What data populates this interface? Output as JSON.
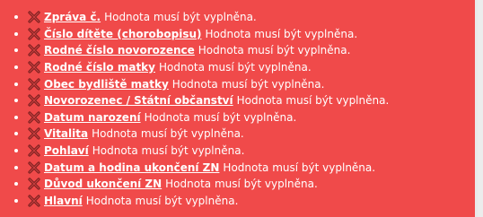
{
  "errors": [
    {
      "field": "Zpráva č.",
      "message": "Hodnota musí být vyplněna."
    },
    {
      "field": "Číslo dítěte (chorobopisu)",
      "message": "Hodnota musí být vyplněna."
    },
    {
      "field": "Rodné číslo novorozence",
      "message": "Hodnota musí být vyplněna."
    },
    {
      "field": "Rodné číslo matky",
      "message": "Hodnota musí být vyplněna."
    },
    {
      "field": "Obec bydliště matky",
      "message": "Hodnota musí být vyplněna."
    },
    {
      "field": "Novorozenec / Státní občanství",
      "message": "Hodnota musí být vyplněna."
    },
    {
      "field": "Datum narození",
      "message": "Hodnota musí být vyplněna."
    },
    {
      "field": "Vitalita",
      "message": "Hodnota musí být vyplněna."
    },
    {
      "field": "Pohlaví",
      "message": "Hodnota musí být vyplněna."
    },
    {
      "field": "Datum a hodina ukončení ZN",
      "message": "Hodnota musí být vyplněna."
    },
    {
      "field": "Důvod ukončení ZN",
      "message": "Hodnota musí být vyplněna."
    },
    {
      "field": "Hlavní",
      "message": "Hodnota musí být vyplněna."
    }
  ],
  "icons": {
    "error": "error-x-icon"
  },
  "colors": {
    "panel_background": "#f04a4a",
    "text": "#ffffff",
    "icon_fill": "#7a1f1f"
  }
}
